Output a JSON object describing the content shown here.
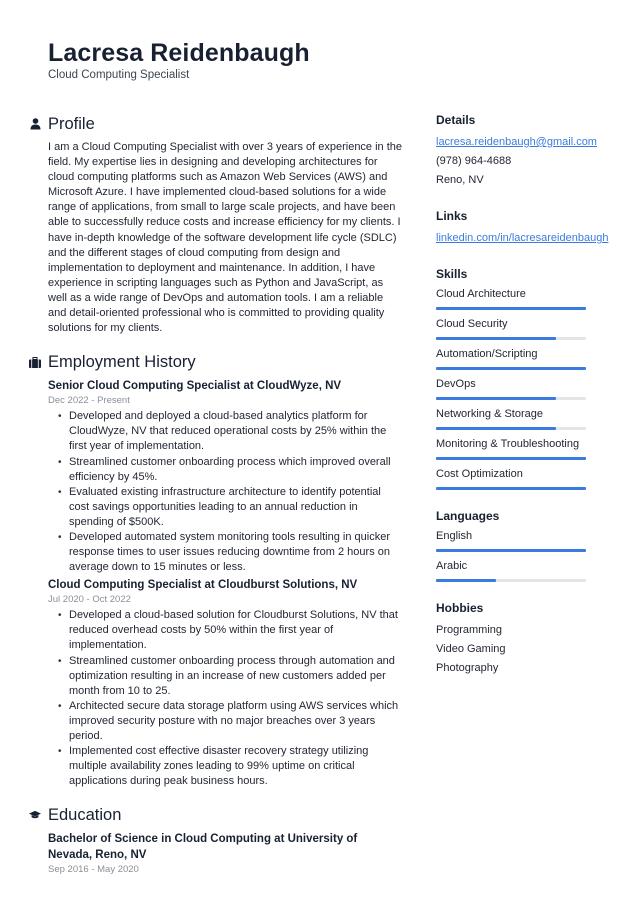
{
  "header": {
    "name": "Lacresa Reidenbaugh",
    "title": "Cloud Computing Specialist"
  },
  "profile": {
    "heading": "Profile",
    "icon": "user-icon",
    "text": "I am a Cloud Computing Specialist with over 3 years of experience in the field. My expertise lies in designing and developing architectures for cloud computing platforms such as Amazon Web Services (AWS) and Microsoft Azure. I have implemented cloud-based solutions for a wide range of applications, from small to large scale projects, and have been able to successfully reduce costs and increase efficiency for my clients. I have in-depth knowledge of the software development life cycle (SDLC) and the different stages of cloud computing from design and implementation to deployment and maintenance. In addition, I have experience in scripting languages such as Python and JavaScript, as well as a wide range of DevOps and automation tools. I am a reliable and detail-oriented professional who is committed to providing quality solutions for my clients."
  },
  "employment": {
    "heading": "Employment History",
    "icon": "briefcase-icon",
    "jobs": [
      {
        "title": "Senior Cloud Computing Specialist at CloudWyze, NV",
        "dates": "Dec 2022 - Present",
        "bullets": [
          "Developed and deployed a cloud-based analytics platform for CloudWyze, NV that reduced operational costs by 25% within the first year of implementation.",
          "Streamlined customer onboarding process which improved overall efficiency by 45%.",
          "Evaluated existing infrastructure architecture to identify potential cost savings opportunities leading to an annual reduction in spending of $500K.",
          "Developed automated system monitoring tools resulting in quicker response times to user issues reducing downtime from 2 hours on average down to 15 minutes or less."
        ]
      },
      {
        "title": "Cloud Computing Specialist at Cloudburst Solutions, NV",
        "dates": "Jul 2020 - Oct 2022",
        "bullets": [
          "Developed a cloud-based solution for Cloudburst Solutions, NV that reduced overhead costs by 50% within the first year of implementation.",
          "Streamlined customer onboarding process through automation and optimization resulting in an increase of new customers added per month from 10 to 25.",
          "Architected secure data storage platform using AWS services which improved security posture with no major breaches over 3 years period.",
          "Implemented cost effective disaster recovery strategy utilizing multiple availability zones leading to 99% uptime on critical applications during peak business hours."
        ]
      }
    ]
  },
  "education": {
    "heading": "Education",
    "icon": "graduation-cap-icon",
    "items": [
      {
        "title": "Bachelor of Science in Cloud Computing at University of Nevada, Reno, NV",
        "dates": "Sep 2016 - May 2020"
      }
    ]
  },
  "details": {
    "heading": "Details",
    "email": "lacresa.reidenbaugh@gmail.com",
    "phone": "(978) 964-4688",
    "location": "Reno, NV"
  },
  "links": {
    "heading": "Links",
    "items": [
      "linkedin.com/in/lacresareidenbaugh"
    ]
  },
  "skills": {
    "heading": "Skills",
    "items": [
      {
        "label": "Cloud Architecture",
        "level": 100
      },
      {
        "label": "Cloud Security",
        "level": 80
      },
      {
        "label": "Automation/Scripting",
        "level": 100
      },
      {
        "label": "DevOps",
        "level": 80
      },
      {
        "label": "Networking & Storage",
        "level": 80
      },
      {
        "label": "Monitoring & Troubleshooting",
        "level": 100
      },
      {
        "label": "Cost Optimization",
        "level": 100
      }
    ]
  },
  "languages": {
    "heading": "Languages",
    "items": [
      {
        "label": "English",
        "level": 100
      },
      {
        "label": "Arabic",
        "level": 40
      }
    ]
  },
  "hobbies": {
    "heading": "Hobbies",
    "items": [
      "Programming",
      "Video Gaming",
      "Photography"
    ]
  },
  "colors": {
    "accent": "#3b7be0",
    "bar_track": "#e3e5e8",
    "heading": "#182132",
    "muted": "#8a8f98"
  }
}
